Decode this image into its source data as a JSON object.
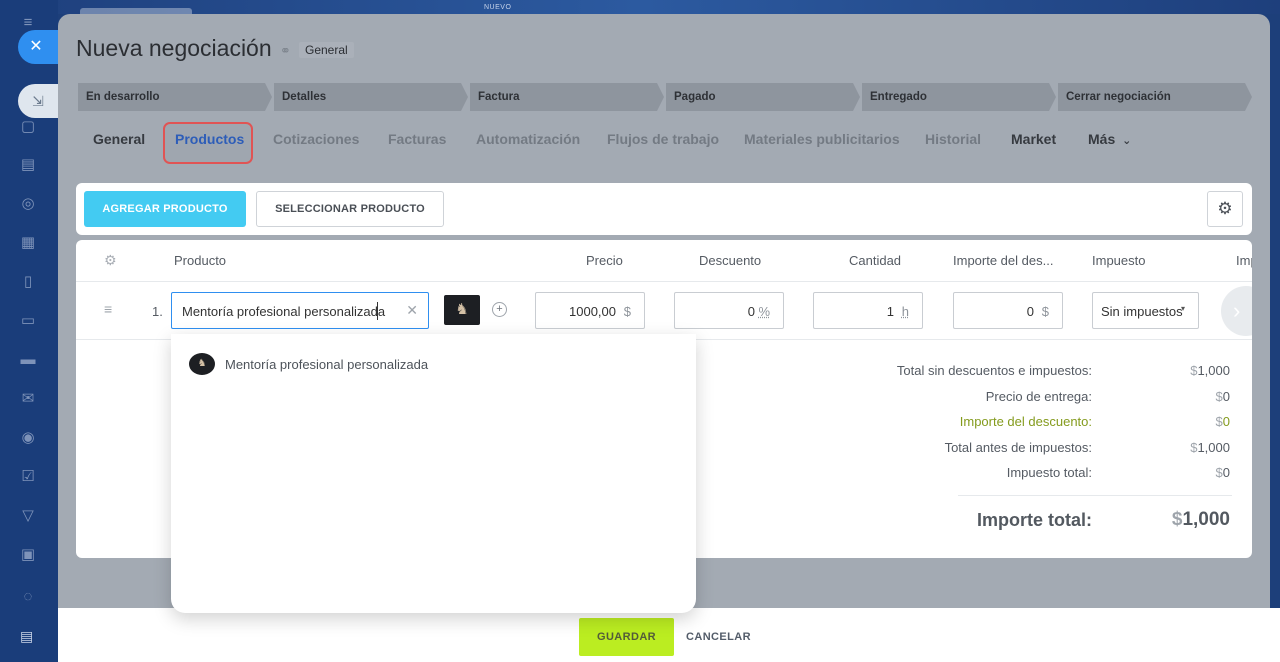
{
  "background": {
    "new_label": "NUEVO"
  },
  "header": {
    "title": "Nueva negociación",
    "category": "General"
  },
  "stages": [
    {
      "label": "En desarrollo"
    },
    {
      "label": "Detalles"
    },
    {
      "label": "Factura"
    },
    {
      "label": "Pagado"
    },
    {
      "label": "Entregado"
    },
    {
      "label": "Cerrar negociación"
    }
  ],
  "tabs": [
    {
      "label": "General"
    },
    {
      "label": "Productos"
    },
    {
      "label": "Cotizaciones"
    },
    {
      "label": "Facturas"
    },
    {
      "label": "Automatización"
    },
    {
      "label": "Flujos de trabajo"
    },
    {
      "label": "Materiales publicitarios"
    },
    {
      "label": "Historial"
    },
    {
      "label": "Market"
    },
    {
      "label": "Más"
    }
  ],
  "toolbar": {
    "add_label": "AGREGAR PRODUCTO",
    "select_label": "SELECCIONAR PRODUCTO"
  },
  "table": {
    "columns": [
      "Producto",
      "Precio",
      "Descuento",
      "Cantidad",
      "Importe del des...",
      "Impuesto",
      "Imp"
    ],
    "rows": [
      {
        "number": "1.",
        "product": "Mentoría profesional personalizada",
        "price": "1000,00",
        "price_currency": "$",
        "discount": "0",
        "discount_unit": "%",
        "quantity": "1",
        "quantity_unit": "h",
        "discount_amount": "0",
        "discount_amount_currency": "$",
        "tax": "Sin impuestos"
      }
    ]
  },
  "dropdown": {
    "items": [
      {
        "label": "Mentoría profesional personalizada"
      }
    ]
  },
  "totals": {
    "subtotal_label": "Total sin descuentos e impuestos:",
    "subtotal_cur": "$",
    "subtotal_val": "1,000",
    "delivery_label": "Precio de entrega:",
    "delivery_cur": "$",
    "delivery_val": "0",
    "discount_label": "Importe del descuento:",
    "discount_cur": "$",
    "discount_val": "0",
    "pretax_label": "Total antes de impuestos:",
    "pretax_cur": "$",
    "pretax_val": "1,000",
    "tax_label": "Impuesto total:",
    "tax_cur": "$",
    "tax_val": "0",
    "total_label": "Importe total:",
    "total_cur": "$",
    "total_val": "1,000"
  },
  "footer": {
    "save_label": "GUARDAR",
    "cancel_label": "CANCELAR"
  },
  "colors": {
    "accent_blue": "#2f8ff0",
    "add_button": "#43cbf2",
    "save_button": "#bbed21",
    "tab_highlight": "#e05454",
    "discount_green": "#849b1d"
  }
}
